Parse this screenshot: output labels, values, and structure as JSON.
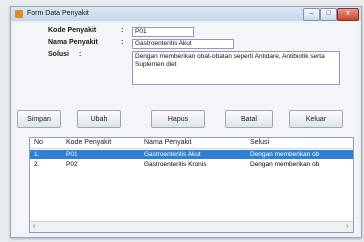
{
  "window": {
    "title": "Form Data Penyakit",
    "min": "–",
    "max": "□",
    "close": "x"
  },
  "form": {
    "kode_label": "Kode Penyakit",
    "nama_label": "Nama Penyakit",
    "solusi_label": "Solusi",
    "colon": ":",
    "kode_value": "P01",
    "nama_value": "Gastroenteritis Akut",
    "solusi_value": "Dengan memberikan obat-obatan seperti Antidare, Antibiotik serta Suplemen diet"
  },
  "buttons": {
    "simpan": "Simpan",
    "ubah": "Ubah",
    "hapus": "Hapus",
    "batal": "Batal",
    "keluar": "Keluar"
  },
  "grid": {
    "headers": [
      "No",
      "Kode Penyakit",
      "Nama Penyakit",
      "Selusi"
    ],
    "rows": [
      [
        "1.",
        "P01",
        "Gastroenteritis Akut",
        "Dengan memberikan ob"
      ],
      [
        "2.",
        "P02",
        "Gastroenteritis Kronis",
        "Dengan memberikan ob"
      ]
    ],
    "scroll_left": "‹",
    "scroll_right": "›"
  }
}
